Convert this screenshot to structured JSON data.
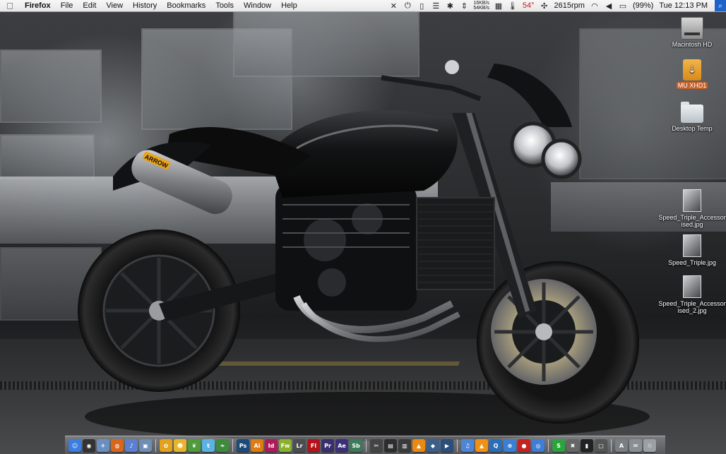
{
  "menubar": {
    "apple_icon": "apple-logo-icon",
    "items": [
      {
        "label": "Firefox",
        "app": true
      },
      {
        "label": "File"
      },
      {
        "label": "Edit"
      },
      {
        "label": "View"
      },
      {
        "label": "History"
      },
      {
        "label": "Bookmarks"
      },
      {
        "label": "Tools"
      },
      {
        "label": "Window"
      },
      {
        "label": "Help"
      }
    ],
    "status": {
      "net_up": "16KB/s",
      "net_down": "54KB/s",
      "temperature": "54°",
      "fan": "2615rpm",
      "battery": "(99%)",
      "clock": "Tue 12:13 PM"
    }
  },
  "desktop": {
    "icons": [
      {
        "name": "Macintosh HD",
        "kind": "hard-drive-icon"
      },
      {
        "name": "MU XHD1",
        "kind": "usb-drive-icon",
        "selected": true
      },
      {
        "name": "Desktop Temp",
        "kind": "folder-icon"
      },
      {
        "name": "Speed_Triple_Accessorised.jpg",
        "kind": "image-file-icon"
      },
      {
        "name": "Speed_Triple.jpg",
        "kind": "image-file-icon"
      },
      {
        "name": "Speed_Triple_Accessorised_2.jpg",
        "kind": "image-file-icon"
      }
    ]
  },
  "wallpaper": {
    "exhaust_brand": "ARROW"
  },
  "dock": {
    "items": [
      {
        "name": "finder",
        "glyph": "☺",
        "color": "#3b7de0"
      },
      {
        "name": "dashboard",
        "glyph": "◉",
        "color": "#333333"
      },
      {
        "name": "mail",
        "glyph": "✈",
        "color": "#6a8fbf"
      },
      {
        "name": "firefox",
        "glyph": "◍",
        "color": "#d8661c"
      },
      {
        "name": "itunes",
        "glyph": "♪",
        "color": "#5b7fd1"
      },
      {
        "name": "preview",
        "glyph": "▣",
        "color": "#6e8fb3"
      },
      {
        "sep": true
      },
      {
        "name": "adium",
        "glyph": "✿",
        "color": "#e2a21c"
      },
      {
        "name": "smile",
        "glyph": "☻",
        "color": "#e6b52a"
      },
      {
        "name": "leaf",
        "glyph": "❦",
        "color": "#4d9b3a"
      },
      {
        "name": "twitter",
        "glyph": "t",
        "color": "#5ab4e3"
      },
      {
        "name": "bamboo",
        "glyph": "❧",
        "color": "#3e8b3b"
      },
      {
        "sep": true
      },
      {
        "name": "photoshop",
        "glyph": "Ps",
        "color": "#1c4a7a"
      },
      {
        "name": "illustrator",
        "glyph": "Ai",
        "color": "#e07b10"
      },
      {
        "name": "indesign",
        "glyph": "Id",
        "color": "#b01a5c"
      },
      {
        "name": "fireworks",
        "glyph": "Fw",
        "color": "#8bb02c"
      },
      {
        "name": "lightroom",
        "glyph": "Lr",
        "color": "#4a4d52"
      },
      {
        "name": "flash",
        "glyph": "Fl",
        "color": "#b3141b"
      },
      {
        "name": "premiere",
        "glyph": "Pr",
        "color": "#3b2e6e"
      },
      {
        "name": "after-effects",
        "glyph": "Ae",
        "color": "#3b2e7a"
      },
      {
        "name": "soundbooth",
        "glyph": "Sb",
        "color": "#3c7a5a"
      },
      {
        "sep": true
      },
      {
        "name": "clapper",
        "glyph": "✂",
        "color": "#444444"
      },
      {
        "name": "final-cut",
        "glyph": "▤",
        "color": "#2d2d2d"
      },
      {
        "name": "motion",
        "glyph": "▥",
        "color": "#3a3a3a"
      },
      {
        "name": "vlc-cone",
        "glyph": "▲",
        "color": "#ea8a12"
      },
      {
        "name": "compressor",
        "glyph": "◆",
        "color": "#3b5f8c"
      },
      {
        "name": "dvd-player",
        "glyph": "▶",
        "color": "#2b4f7a"
      },
      {
        "sep": true
      },
      {
        "name": "itunes-2",
        "glyph": "♫",
        "color": "#4d86d6"
      },
      {
        "name": "vlc",
        "glyph": "▲",
        "color": "#f09014"
      },
      {
        "name": "quicktime",
        "glyph": "Q",
        "color": "#2a6db8"
      },
      {
        "name": "network",
        "glyph": "⊕",
        "color": "#3a7fd5"
      },
      {
        "name": "stop",
        "glyph": "●",
        "color": "#c62222"
      },
      {
        "name": "safari",
        "glyph": "◎",
        "color": "#3e7ed4"
      },
      {
        "sep": true
      },
      {
        "name": "skype",
        "glyph": "S",
        "color": "#2aa43c"
      },
      {
        "name": "x11",
        "glyph": "✖",
        "color": "#666666"
      },
      {
        "name": "terminal",
        "glyph": "▮",
        "color": "#222222"
      },
      {
        "name": "console",
        "glyph": "▢",
        "color": "#555555"
      },
      {
        "sep": true
      },
      {
        "name": "applications",
        "glyph": "A",
        "color": "#7a7f86"
      },
      {
        "name": "documents",
        "glyph": "✉",
        "color": "#8a8f96"
      },
      {
        "name": "trash",
        "glyph": "♲",
        "color": "#9aa0a6"
      }
    ]
  }
}
